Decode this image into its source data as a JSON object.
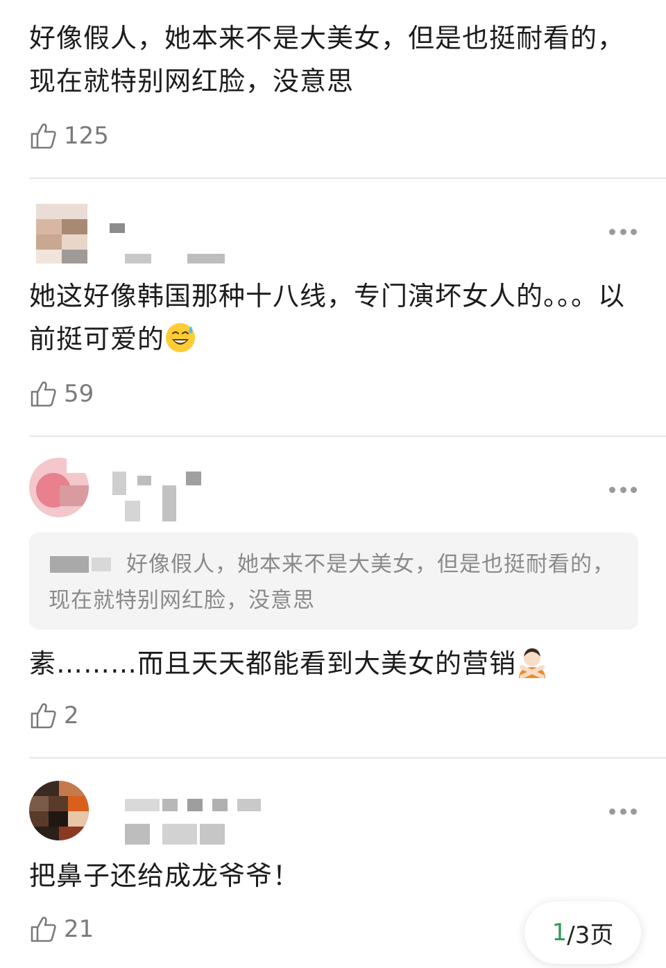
{
  "comments": [
    {
      "text": "好像假人，她本来不是大美女，但是也挺耐看的，现在就特别网红脸，没意思",
      "likes": "125"
    },
    {
      "text": "她这好像韩国那种十八线，专门演坏女人的。。。以前挺可爱的",
      "emoji": "sweat-smile-emoji",
      "likes": "59"
    },
    {
      "quote_text": "好像假人，她本来不是大美女，但是也挺耐看的，现在就特别网红脸，没意思",
      "text": "素………而且天天都能看到大美女的营销",
      "emoji": "no-gesture-emoji",
      "likes": "2"
    },
    {
      "text": "把鼻子还给成龙爷爷！",
      "likes": "21"
    }
  ],
  "pager": {
    "current": "1",
    "rest": "/3页"
  },
  "colors": {
    "accent": "#2e9a52",
    "like_icon": "#7a7a7a",
    "quote_bg": "#f4f4f4"
  }
}
